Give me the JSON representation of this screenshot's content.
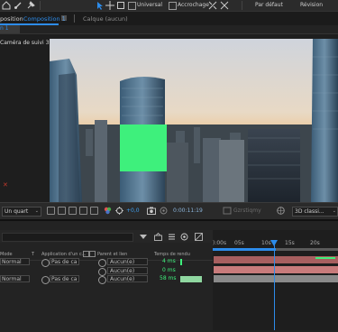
{
  "toolbar": {
    "universal_label": "Universal",
    "snap_label": "Accrochage",
    "default_label": "Par défaut",
    "review_label": "Révision"
  },
  "comp_panel": {
    "tab_prefix": "position",
    "tab_active": "Composition 1",
    "layer_tab": "Calque  (aucun)",
    "subtab": "n 1",
    "camera_label": "Caméra de suivi 3D)"
  },
  "viewer_bar": {
    "resolution": "Un quart",
    "exposure": "+0,0",
    "timecode": "0:00:11:19",
    "renderer": "Gzrstiqmy",
    "view_mode": "3D classi..."
  },
  "timeline": {
    "headers": {
      "mode": "Mode",
      "t": "T",
      "apply": "Application d'un c...",
      "parent": "Parent et lien",
      "render_time": "Temps de rendu"
    },
    "rows": [
      {
        "mode": "Normal",
        "apply": "Pas de ca",
        "parent": "Aucun(e)",
        "render_ms": "4 ms"
      },
      {
        "mode": "",
        "apply": "",
        "parent": "Aucun(e)",
        "render_ms": "0 ms"
      },
      {
        "mode": "Normal",
        "apply": "Pas de ca",
        "parent": "Aucun(e)",
        "render_ms": "58 ms"
      }
    ],
    "ruler": [
      "0s",
      "05s",
      "10s",
      "15s",
      "20s"
    ],
    "ruler_first": "):00s"
  },
  "colors": {
    "accent_blue": "#2d8ceb",
    "green_solid": "#3ef07c",
    "layer_red": "#c87b7b",
    "layer_gray": "#8a8a8a"
  },
  "icons": [
    "arrow-icon",
    "hand-icon",
    "zoom-icon",
    "selection-icon",
    "rectangle-icon",
    "pen-icon",
    "text-icon",
    "expand-icon",
    "grid-icon",
    "camera-icon",
    "globe-icon"
  ]
}
